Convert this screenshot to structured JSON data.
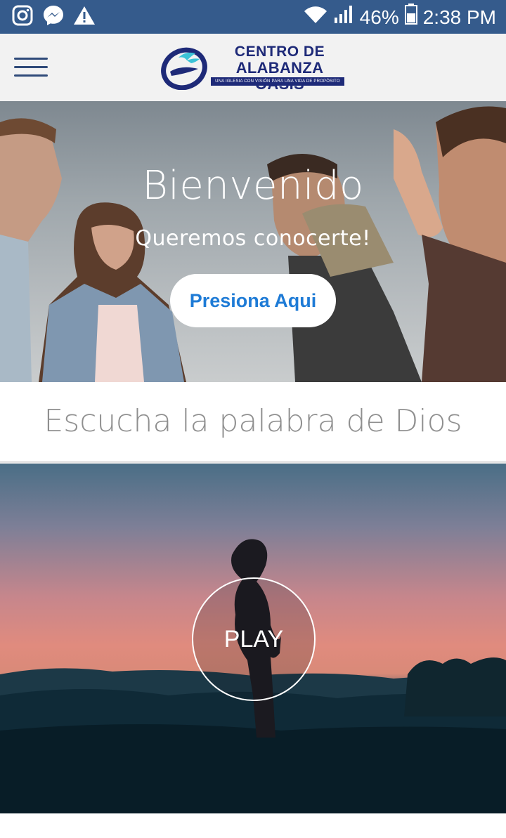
{
  "status_bar": {
    "icons_left": [
      "instagram-icon",
      "messenger-icon",
      "warning-icon"
    ],
    "icons_right": [
      "wifi-icon",
      "signal-icon"
    ],
    "battery": "46%",
    "time": "2:38 PM",
    "background": "#355b8c"
  },
  "header": {
    "logo": {
      "line1": "CENTRO DE",
      "line2": "ALABANZA OASIS",
      "tagline": "UNA IGLESIA CON VISIÓN PARA UNA VIDA DE PROPÓSITO"
    },
    "menu_icon": "hamburger-menu-icon"
  },
  "hero": {
    "title": "Bienvenido",
    "subtitle": "Queremos conocerte!",
    "button_label": "Presiona Aqui",
    "button_color": "#1e7bd6"
  },
  "section": {
    "heading": "Escucha la palabra de Dios"
  },
  "media": {
    "play_label": "PLAY"
  }
}
